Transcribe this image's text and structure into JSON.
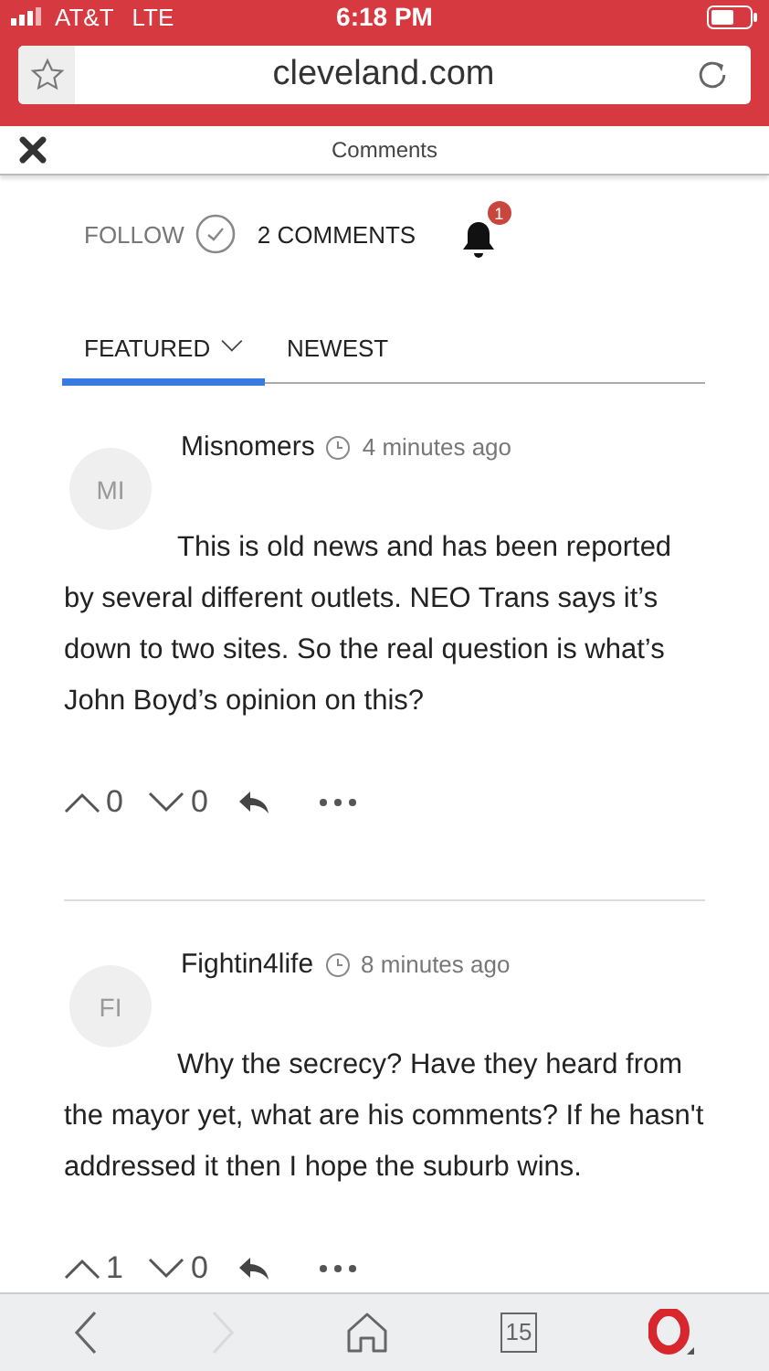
{
  "status_bar": {
    "carrier": "AT&T",
    "network": "LTE",
    "time": "6:18 PM"
  },
  "address_bar": {
    "url": "cleveland.com"
  },
  "header": {
    "title": "Comments"
  },
  "follow": {
    "label": "FOLLOW",
    "comment_count": "2 COMMENTS",
    "notification_count": "1"
  },
  "tabs": [
    {
      "label": "FEATURED",
      "selected": true,
      "dropdown": true
    },
    {
      "label": "NEWEST",
      "selected": false,
      "dropdown": false
    }
  ],
  "comments": [
    {
      "initials": "MI",
      "author": "Misnomers",
      "time": "4 minutes ago",
      "body": "This is old news and has been reported by several different outlets. NEO Trans says it’s down to two sites. So the real question is what’s John Boyd’s opinion on this?",
      "upvotes": "0",
      "downvotes": "0"
    },
    {
      "initials": "FI",
      "author": "Fightin4life",
      "time": "8 minutes ago",
      "body": "Why the secrecy? Have they heard from the mayor yet, what are his comments? If he hasn't addressed it then I hope the suburb wins.",
      "upvotes": "1",
      "downvotes": "0"
    }
  ],
  "toolbar": [
    {
      "kind": "back",
      "disabled": false
    },
    {
      "kind": "forward",
      "disabled": true
    },
    {
      "kind": "home",
      "disabled": false
    },
    {
      "kind": "tabs",
      "label": "15",
      "disabled": false
    },
    {
      "kind": "menu",
      "disabled": false
    }
  ]
}
